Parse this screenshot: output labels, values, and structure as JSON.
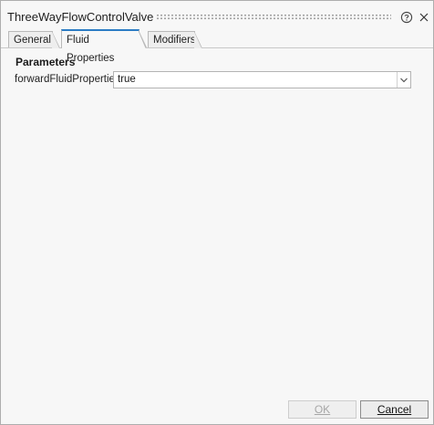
{
  "window": {
    "title": "ThreeWayFlowControlValve"
  },
  "tabs": [
    {
      "label": "General",
      "active": false
    },
    {
      "label": "Fluid Properties",
      "active": true
    },
    {
      "label": "Modifiers",
      "active": false
    }
  ],
  "parameters": {
    "section_title": "Parameters",
    "fields": [
      {
        "label": "forwardFluidProperties",
        "value": "true"
      }
    ]
  },
  "buttons": {
    "ok_label": "OK",
    "ok_enabled": false,
    "cancel_label": "Cancel"
  },
  "icons": {
    "help": "help-circle-icon",
    "close": "close-icon",
    "dropdown": "chevron-down-icon"
  },
  "colors": {
    "active_tab_accent": "#2c7cc4",
    "background": "#f7f7f7"
  }
}
